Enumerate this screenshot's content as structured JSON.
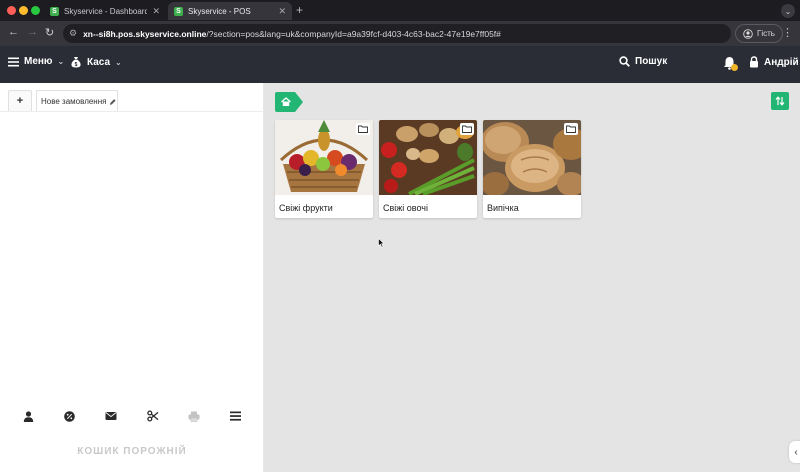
{
  "browser": {
    "tabs": [
      {
        "title": "Skyservice - Dashboard",
        "favicon": "S",
        "active": false
      },
      {
        "title": "Skyservice - POS",
        "favicon": "S",
        "active": true
      }
    ],
    "new_tab": "+",
    "address": {
      "host": "xn--si8h.pos.skyservice.online",
      "path": "/?section=pos&lang=uk&companyId=a9a39fcf-d403-4c63-bac2-47e19e7ff05f#"
    },
    "profile_label": "Гість"
  },
  "header": {
    "menu_label": "Меню",
    "cash_label": "Каса",
    "search_label": "Пошук",
    "user_name": "Андрій",
    "notification_count": "1"
  },
  "left_panel": {
    "add_label": "+",
    "order_tab_label": "Нове замовлення",
    "empty_cart_label": "КОШИК ПОРОЖНІЙ",
    "tools": [
      "user-icon",
      "percent-icon",
      "envelope-icon",
      "scissors-icon",
      "printer-icon",
      "list-icon"
    ]
  },
  "categories": [
    {
      "name": "Свіжі фрукти",
      "image": "fruit-basket"
    },
    {
      "name": "Свіжі овочі",
      "image": "vegetables"
    },
    {
      "name": "Випічка",
      "image": "bread"
    }
  ],
  "colors": {
    "accent": "#22b573",
    "header_bg": "#2a2d36",
    "main_bg": "#e4e4e4"
  }
}
